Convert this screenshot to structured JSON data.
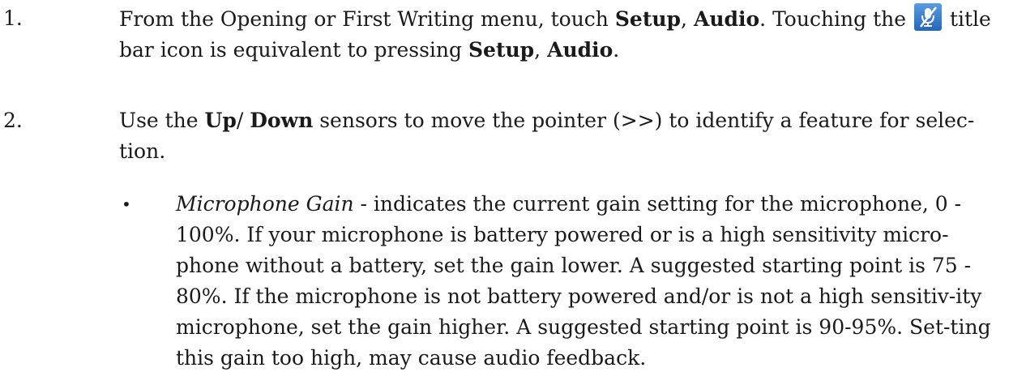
{
  "steps": [
    {
      "number": "1.",
      "parts": {
        "t1": "From the Opening or First Writing menu, touch ",
        "b1": "Setup",
        "t2": ", ",
        "b2": "Audio",
        "t3": ". Touching the ",
        "t4": " title bar icon is equivalent to pressing ",
        "b3": "Setup",
        "t5": ", ",
        "b4": "Audio",
        "t6": "."
      },
      "icon": "microphone-muted-icon"
    },
    {
      "number": "2.",
      "parts": {
        "t1": "Use the ",
        "b1": "Up",
        "t2": "/ ",
        "b2": "Down",
        "t3": " sensors to move the pointer (>>) to identify a feature for selec-tion."
      }
    }
  ],
  "bullets": [
    {
      "symbol": "•",
      "term": "Microphone Gain",
      "text": " - indicates the current gain setting for the microphone, 0 - 100%. If your microphone is battery powered or is a high sensitivity micro-phone without a battery, set the gain lower. A suggested starting point is 75 - 80%. If the microphone is not battery powered and/or is not a high sensitiv-ity microphone, set the gain higher. A suggested starting point is 90-95%. Set-ting this gain too high, may cause audio feedback."
    }
  ]
}
